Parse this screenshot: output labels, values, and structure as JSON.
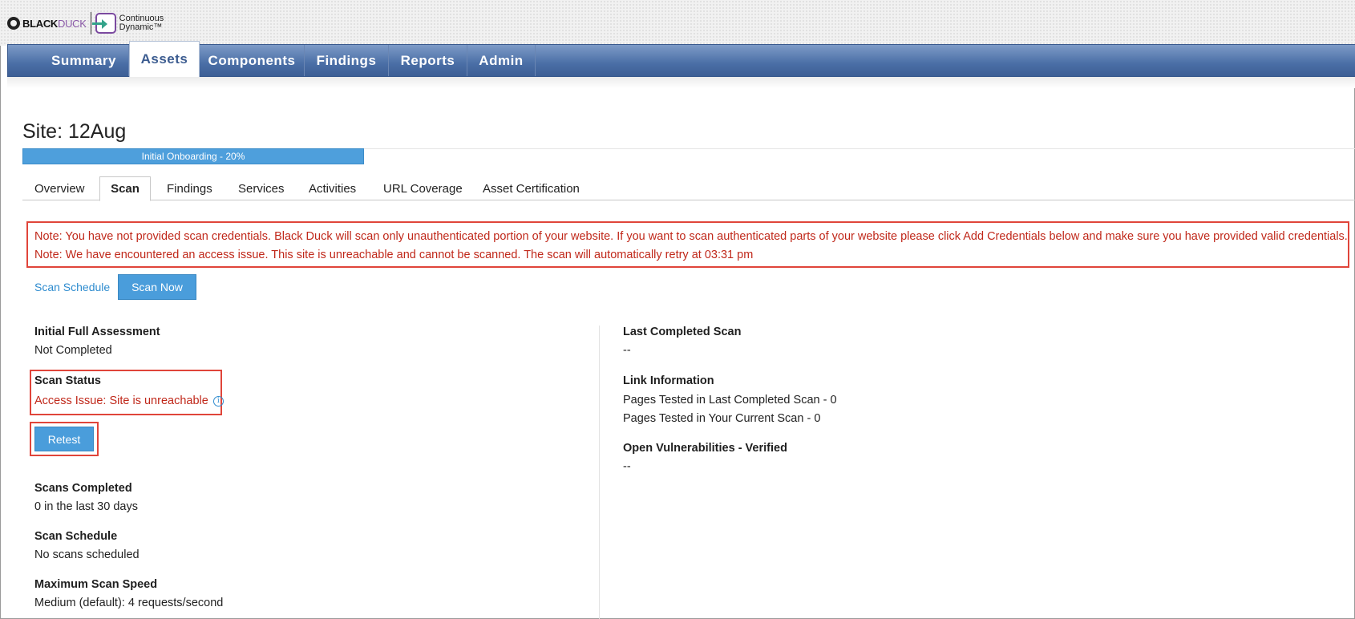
{
  "header": {
    "brand_black": "BLACK",
    "brand_duck": "DUCK",
    "product_line1": "Continuous",
    "product_line2": "Dynamic™"
  },
  "nav": {
    "items": [
      {
        "label": "Summary"
      },
      {
        "label": "Assets"
      },
      {
        "label": "Components"
      },
      {
        "label": "Findings"
      },
      {
        "label": "Reports"
      },
      {
        "label": "Admin"
      }
    ],
    "active": "Assets"
  },
  "site": {
    "title": "Site: 12Aug",
    "progress_label": "Initial Onboarding - 20%",
    "progress_percent": 20
  },
  "subtabs": {
    "items": [
      {
        "label": "Overview"
      },
      {
        "label": "Scan"
      },
      {
        "label": "Findings"
      },
      {
        "label": "Services"
      },
      {
        "label": "Activities"
      },
      {
        "label": "URL Coverage"
      },
      {
        "label": "Asset Certification"
      }
    ],
    "active": "Scan"
  },
  "notes": [
    "Note: You have not provided scan credentials. Black Duck will scan only unauthenticated portion of your website. If you want to scan authenticated parts of your website please click Add Credentials below and make sure you have provided valid credentials.",
    "Note: We have encountered an access issue. This site is unreachable and cannot be scanned. The scan will automatically retry at 03:31 pm"
  ],
  "actions": {
    "scan_schedule_link": "Scan Schedule",
    "scan_now_button": "Scan Now",
    "retest_button": "Retest"
  },
  "left": {
    "initial_full_assessment": {
      "label": "Initial Full Assessment",
      "value": "Not Completed"
    },
    "scan_status": {
      "label": "Scan Status",
      "value": "Access Issue: Site is unreachable",
      "info_icon": "info-icon"
    },
    "scans_completed": {
      "label": "Scans Completed",
      "value": "0 in the last 30 days"
    },
    "scan_schedule": {
      "label": "Scan Schedule",
      "value": "No scans scheduled"
    },
    "max_scan_speed": {
      "label": "Maximum Scan Speed",
      "value": "Medium (default): 4 requests/second"
    }
  },
  "right": {
    "last_completed_scan": {
      "label": "Last Completed Scan",
      "value": "--"
    },
    "link_information": {
      "label": "Link Information",
      "line1": "Pages Tested in Last Completed Scan - 0",
      "line2": "Pages Tested in Your Current Scan - 0"
    },
    "open_vulns": {
      "label": "Open Vulnerabilities - Verified",
      "value": "--"
    }
  },
  "colors": {
    "nav_blue": "#4a6ea6",
    "accent_blue": "#4a9ddb",
    "link_blue": "#2f8ccf",
    "error_red": "#c0281a",
    "highlight_red": "#e0453a"
  }
}
